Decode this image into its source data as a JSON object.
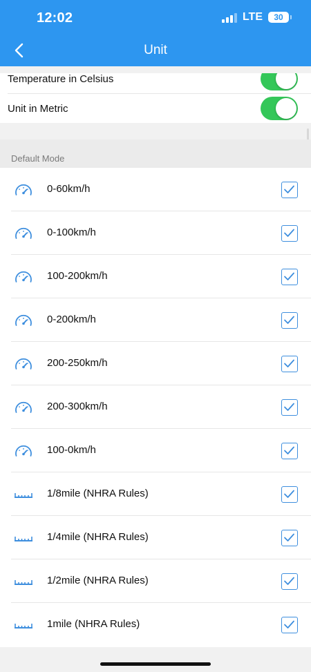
{
  "status_bar": {
    "time": "12:02",
    "network": "LTE",
    "battery": "30"
  },
  "nav": {
    "title": "Unit"
  },
  "toggles": [
    {
      "label": "Temperature in Celsius",
      "on": true
    },
    {
      "label": "Unit in Metric",
      "on": true
    }
  ],
  "section": {
    "title": "Default Mode"
  },
  "modes": [
    {
      "icon": "speedometer-icon",
      "label": "0-60km/h",
      "checked": true
    },
    {
      "icon": "speedometer-icon",
      "label": "0-100km/h",
      "checked": true
    },
    {
      "icon": "speedometer-icon",
      "label": "100-200km/h",
      "checked": true
    },
    {
      "icon": "speedometer-icon",
      "label": "0-200km/h",
      "checked": true
    },
    {
      "icon": "speedometer-icon",
      "label": "200-250km/h",
      "checked": true
    },
    {
      "icon": "speedometer-icon",
      "label": "200-300km/h",
      "checked": true
    },
    {
      "icon": "speedometer-icon",
      "label": "100-0km/h",
      "checked": true
    },
    {
      "icon": "ruler-icon",
      "label": "1/8mile (NHRA Rules)",
      "checked": true
    },
    {
      "icon": "ruler-icon",
      "label": "1/4mile (NHRA Rules)",
      "checked": true
    },
    {
      "icon": "ruler-icon",
      "label": "1/2mile (NHRA Rules)",
      "checked": true
    },
    {
      "icon": "ruler-icon",
      "label": "1mile (NHRA Rules)",
      "checked": true
    }
  ],
  "colors": {
    "header": "#2d96f0",
    "toggle_on": "#34c759",
    "icon_blue": "#3d8ede"
  }
}
